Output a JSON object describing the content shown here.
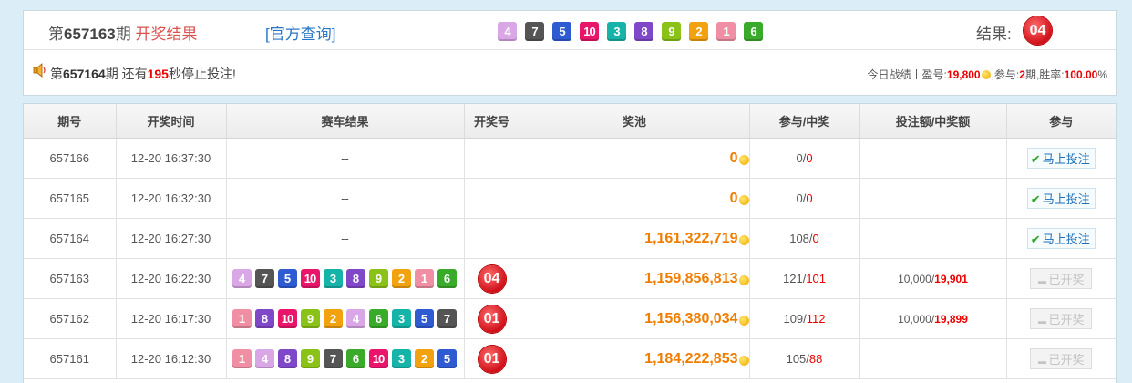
{
  "header": {
    "period_prefix": "第",
    "period_number": "657163",
    "period_suffix": "期",
    "period_status": "开奖结果",
    "official_link": "[官方查询]",
    "draw_numbers": [
      "4",
      "7",
      "5",
      "10",
      "3",
      "8",
      "9",
      "2",
      "1",
      "6"
    ],
    "result_label": "结果:",
    "result_value": "04"
  },
  "countdown": {
    "prefix": "第",
    "period": "657164",
    "mid": "期 还有",
    "seconds": "195",
    "suffix": "秒停止投注!"
  },
  "today_stats": {
    "label": "今日战绩丨盈号:",
    "profit": "19,800",
    "participate_label": ",参与:",
    "participate": "2",
    "period_unit": "期,胜率:",
    "win_rate": "100.00",
    "percent": "%"
  },
  "ball_colors": {
    "1": "#f08fa4",
    "2": "#f2a20f",
    "3": "#16b3a8",
    "4": "#d9a6e6",
    "5": "#2e5bd1",
    "6": "#3aaa2a",
    "7": "#555555",
    "8": "#7f48c9",
    "9": "#8bc218",
    "10": "#e8156a"
  },
  "table": {
    "headers": [
      "期号",
      "开奖时间",
      "赛车结果",
      "开奖号",
      "奖池",
      "参与/中奖",
      "投注额/中奖额",
      "参与"
    ],
    "bet_label": "马上投注",
    "opened_label": "已开奖",
    "rows": [
      {
        "period": "657166",
        "time": "12-20  16:37:30",
        "race": "--",
        "balls": [],
        "result": "",
        "pool": "0",
        "participants": "0",
        "winners": "0",
        "bet": "",
        "win": "",
        "action": "bet"
      },
      {
        "period": "657165",
        "time": "12-20  16:32:30",
        "race": "--",
        "balls": [],
        "result": "",
        "pool": "0",
        "participants": "0",
        "winners": "0",
        "bet": "",
        "win": "",
        "action": "bet"
      },
      {
        "period": "657164",
        "time": "12-20  16:27:30",
        "race": "--",
        "balls": [],
        "result": "",
        "pool": "1,161,322,719",
        "participants": "108",
        "winners": "0",
        "bet": "",
        "win": "",
        "action": "bet"
      },
      {
        "period": "657163",
        "time": "12-20  16:22:30",
        "race": "",
        "balls": [
          "4",
          "7",
          "5",
          "10",
          "3",
          "8",
          "9",
          "2",
          "1",
          "6"
        ],
        "result": "04",
        "pool": "1,159,856,813",
        "participants": "121",
        "winners": "101",
        "bet": "10,000",
        "win": "19,901",
        "action": "opened"
      },
      {
        "period": "657162",
        "time": "12-20  16:17:30",
        "race": "",
        "balls": [
          "1",
          "8",
          "10",
          "9",
          "2",
          "4",
          "6",
          "3",
          "5",
          "7"
        ],
        "result": "01",
        "pool": "1,156,380,034",
        "participants": "109",
        "winners": "112",
        "bet": "10,000",
        "win": "19,899",
        "action": "opened"
      },
      {
        "period": "657161",
        "time": "12-20  16:12:30",
        "race": "",
        "balls": [
          "1",
          "4",
          "8",
          "9",
          "7",
          "6",
          "10",
          "3",
          "2",
          "5"
        ],
        "result": "01",
        "pool": "1,184,222,853",
        "participants": "105",
        "winners": "88",
        "bet": "",
        "win": "",
        "action": "opened"
      }
    ]
  }
}
